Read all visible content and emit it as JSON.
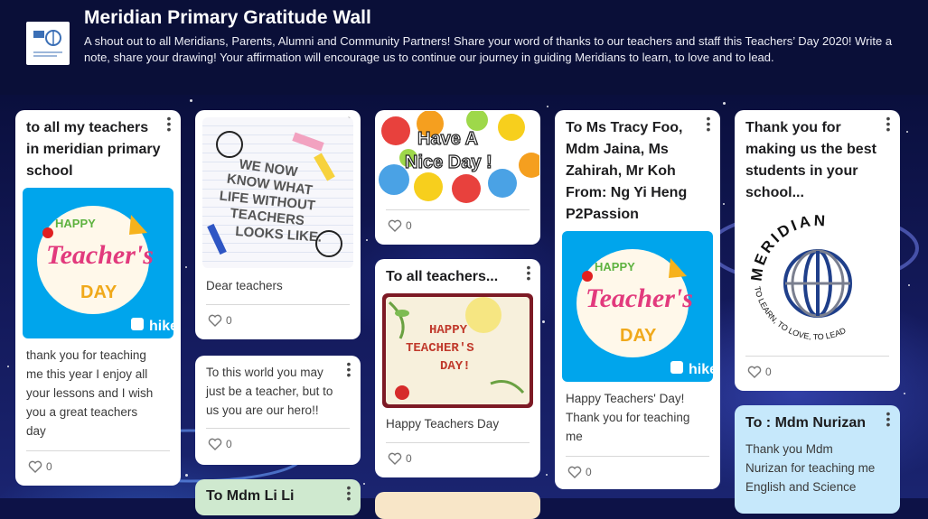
{
  "wall": {
    "title": "Meridian Primary Gratitude Wall",
    "description": "A shout out to all Meridians, Parents, Alumni and Community Partners! Share your word of thanks to our teachers and staff this Teachers’ Day 2020! Write a note, share your drawing! Your affirmation will encourage us to continue our journey in guiding Meridians to learn, to love and to lead."
  },
  "posts": [
    {
      "title_lines": [
        "to all my teachers",
        "in meridian primary",
        "school"
      ],
      "image_text": {
        "l1": "HAPPY",
        "l2": "Teacher's",
        "l3": "DAY",
        "brand": "hike"
      },
      "body_lines": [
        "thank you for teaching",
        "me this year I enjoy all",
        "your lessons and I wish",
        "you a great teachers",
        "day"
      ],
      "likes": "0"
    },
    {
      "image_text": {
        "l1": "WE NOW",
        "l2": "KNOW WHAT",
        "l3": "LIFE WITHOUT",
        "l4": "TEACHERS",
        "l5": "LOOKS LIKE."
      },
      "body": "Dear teachers",
      "likes": "0"
    },
    {
      "body_lines": [
        "To this world you may",
        "just be a teacher,  but to",
        "us you are our hero!!"
      ],
      "likes": "0"
    },
    {
      "title": "To Mdm Li Li"
    },
    {
      "image_text": {
        "l1": "Have A",
        "l2": "Nice Day !"
      },
      "likes": "0"
    },
    {
      "title": "To all teachers...",
      "image_text": {
        "l1": "HAPPY",
        "l2": "TEACHER'S",
        "l3": "DAY!"
      },
      "body": "Happy Teachers Day",
      "likes": "0"
    },
    {
      "title_lines": [
        "To Ms Tracy Foo,",
        "Mdm Jaina, Ms",
        "Zahirah, Mr Koh",
        "From: Ng Yi Heng",
        "P2Passion"
      ],
      "image_text": {
        "l1": "HAPPY",
        "l2": "Teacher's",
        "l3": "DAY",
        "brand": "hike"
      },
      "body_lines": [
        "Happy Teachers' Day!",
        "Thank you for teaching",
        "me"
      ],
      "likes": "0"
    },
    {
      "title_lines": [
        "Thank you for",
        "making us the best",
        "students in your",
        "school..."
      ],
      "image_text": {
        "arc": "MERIDIAN",
        "motto": "TO LEARN, TO LOVE, TO LEAD"
      },
      "likes": "0"
    },
    {
      "title": "To : Mdm Nurizan",
      "body_lines": [
        "Thank you Mdm",
        "Nurizan for teaching me",
        "English and Science"
      ]
    }
  ],
  "colors": {
    "background": "#0d1247",
    "header": "#0a0f38",
    "card": "#ffffff",
    "card_blue": "#c6e8fb",
    "card_green": "#cfe9cf",
    "hike_blue": "#00a5ec"
  }
}
